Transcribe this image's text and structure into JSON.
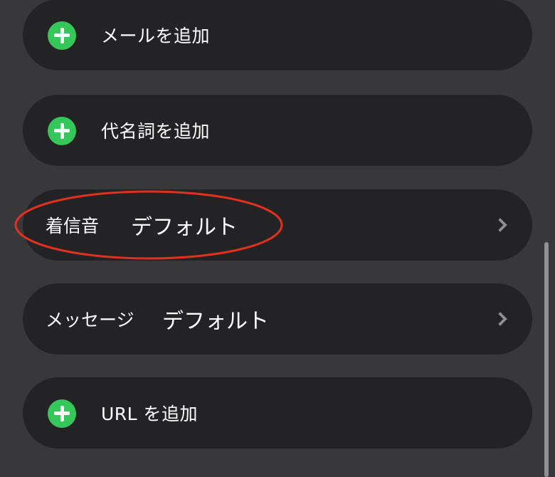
{
  "rows": {
    "add_email": {
      "label": "メールを追加"
    },
    "add_pronoun": {
      "label": "代名詞を追加"
    },
    "ringtone": {
      "label": "着信音",
      "value": "デフォルト"
    },
    "message": {
      "label": "メッセージ",
      "value": "デフォルト"
    },
    "add_url": {
      "label": "URL を追加"
    }
  },
  "icons": {
    "add": "plus-circle-icon",
    "disclosure": "chevron-right-icon"
  },
  "colors": {
    "background": "#38383a",
    "row_background": "#232325",
    "add_icon": "#35c759",
    "chevron": "#8e8e93",
    "annotation": "#e0301e"
  }
}
